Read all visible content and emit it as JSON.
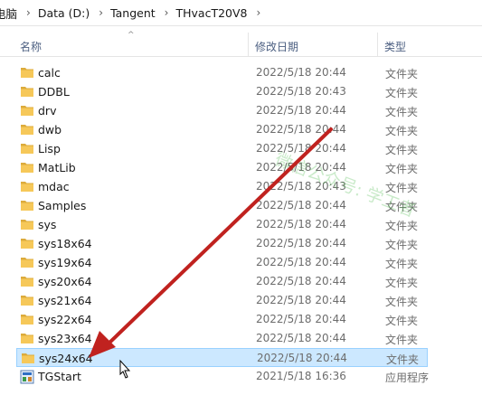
{
  "breadcrumb": [
    "电脑",
    "Data (D:)",
    "Tangent",
    "THvacT20V8"
  ],
  "columns": {
    "name": "名称",
    "date": "修改日期",
    "type": "类型"
  },
  "files": [
    {
      "name": "calc",
      "date": "2022/5/18 20:44",
      "type": "文件夹",
      "icon": "folder-icon"
    },
    {
      "name": "DDBL",
      "date": "2022/5/18 20:43",
      "type": "文件夹",
      "icon": "folder-icon"
    },
    {
      "name": "drv",
      "date": "2022/5/18 20:44",
      "type": "文件夹",
      "icon": "folder-icon"
    },
    {
      "name": "dwb",
      "date": "2022/5/18 20:44",
      "type": "文件夹",
      "icon": "folder-icon"
    },
    {
      "name": "Lisp",
      "date": "2022/5/18 20:44",
      "type": "文件夹",
      "icon": "folder-icon"
    },
    {
      "name": "MatLib",
      "date": "2022/5/18 20:44",
      "type": "文件夹",
      "icon": "folder-icon"
    },
    {
      "name": "mdac",
      "date": "2022/5/18 20:43",
      "type": "文件夹",
      "icon": "folder-icon"
    },
    {
      "name": "Samples",
      "date": "2022/5/18 20:44",
      "type": "文件夹",
      "icon": "folder-icon"
    },
    {
      "name": "sys",
      "date": "2022/5/18 20:44",
      "type": "文件夹",
      "icon": "folder-icon"
    },
    {
      "name": "sys18x64",
      "date": "2022/5/18 20:44",
      "type": "文件夹",
      "icon": "folder-icon"
    },
    {
      "name": "sys19x64",
      "date": "2022/5/18 20:44",
      "type": "文件夹",
      "icon": "folder-icon"
    },
    {
      "name": "sys20x64",
      "date": "2022/5/18 20:44",
      "type": "文件夹",
      "icon": "folder-icon"
    },
    {
      "name": "sys21x64",
      "date": "2022/5/18 20:44",
      "type": "文件夹",
      "icon": "folder-icon"
    },
    {
      "name": "sys22x64",
      "date": "2022/5/18 20:44",
      "type": "文件夹",
      "icon": "folder-icon"
    },
    {
      "name": "sys23x64",
      "date": "2022/5/18 20:44",
      "type": "文件夹",
      "icon": "folder-icon"
    },
    {
      "name": "sys24x64",
      "date": "2022/5/18 20:44",
      "type": "文件夹",
      "icon": "folder-icon",
      "selected": true
    },
    {
      "name": "TGStart",
      "date": "2021/5/18 16:36",
      "type": "应用程序",
      "icon": "application-icon"
    }
  ],
  "watermark": "微信公众号: 学工者",
  "colors": {
    "selection_bg": "#cce8ff",
    "selection_border": "#99d1ff",
    "folder": "#f6c859",
    "arrow": "#c0221f"
  }
}
